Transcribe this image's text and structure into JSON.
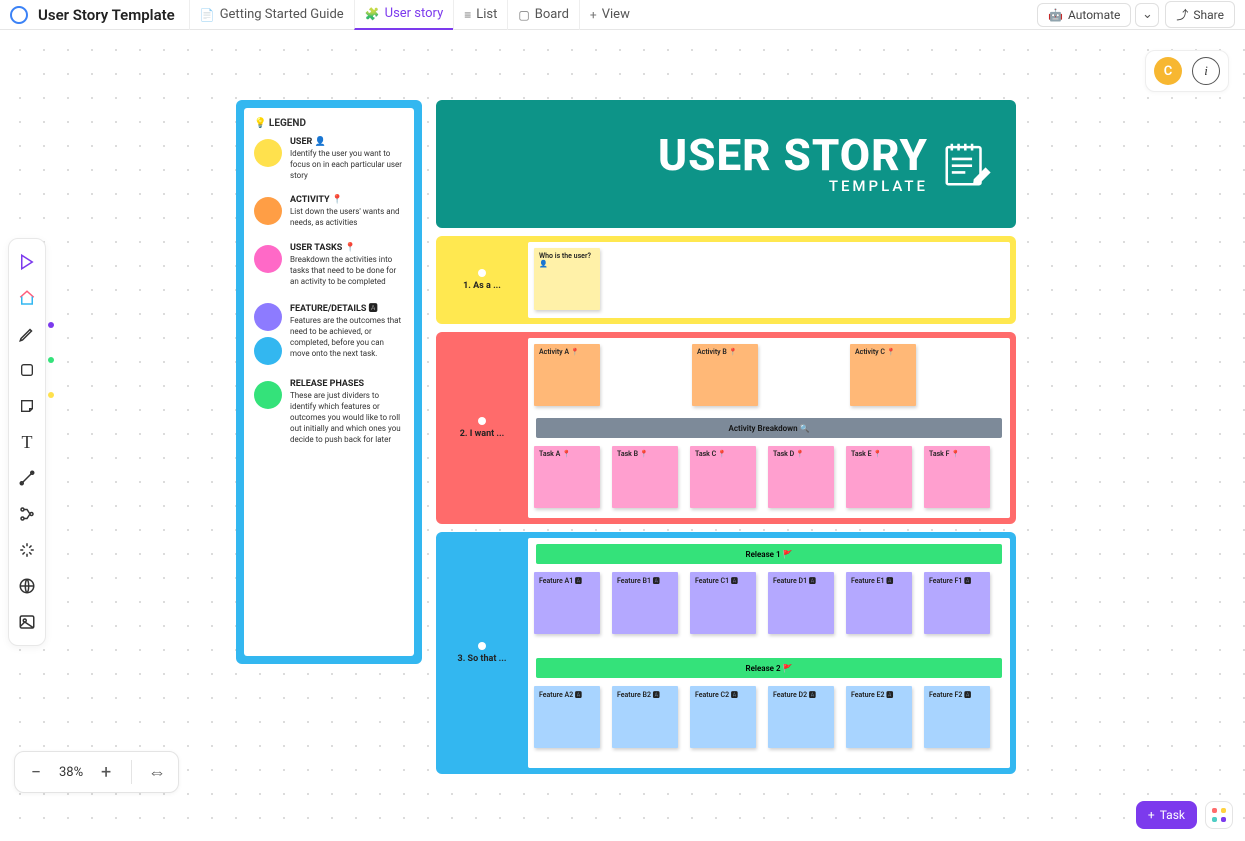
{
  "header": {
    "title": "User Story Template",
    "tabs": [
      {
        "label": "Getting Started Guide",
        "icon": "📄"
      },
      {
        "label": "User story",
        "icon": "🧩",
        "active": true
      },
      {
        "label": "List",
        "icon": "≡"
      },
      {
        "label": "Board",
        "icon": "▢"
      },
      {
        "label": "View",
        "icon": "+"
      }
    ],
    "automate": "Automate",
    "share": "Share"
  },
  "avatar": {
    "initial": "C"
  },
  "zoom": {
    "percent": "38%"
  },
  "bottom": {
    "task": "Task"
  },
  "legend": {
    "title": "💡 LEGEND",
    "items": [
      {
        "color": "#ffe14d",
        "heading": "USER 👤",
        "body": "Identify the user you want to focus on in each particular user story"
      },
      {
        "color": "#ff9e45",
        "heading": "ACTIVITY 📍",
        "body": "List down the users' wants and needs, as activities"
      },
      {
        "color": "#ff69c7",
        "heading": "USER TASKS 📍",
        "body": "Breakdown the activities into tasks that need to be done for an activity to be completed"
      },
      {
        "color": "#8d7bff",
        "heading": "FEATURE/DETAILS 🅰",
        "body": "Features are the outcomes that need to be achieved, or completed, before you can move onto the next task."
      },
      {
        "color2": "#33b7f0",
        "heading2_ignored": ""
      },
      {
        "color": "#34e27a",
        "heading": "RELEASE PHASES",
        "body": "These are just dividers to identify which features or outcomes you would like to roll out initially and which ones you decide to push back for later"
      }
    ],
    "featureSecondCircle": "#33b7f0"
  },
  "hero": {
    "title": "USER STORY",
    "subtitle": "TEMPLATE"
  },
  "sections": {
    "user": {
      "label": "1.  As a ...",
      "sticky": {
        "text": "Who is the user?",
        "emoji": "👤"
      }
    },
    "want": {
      "label": "2.  I want ...",
      "activities": [
        {
          "label": "Activity A 📍"
        },
        {
          "label": "Activity B 📍"
        },
        {
          "label": "Activity C 📍"
        }
      ],
      "breakdownBar": "Activity Breakdown 🔍",
      "tasks": [
        {
          "label": "Task A  📍"
        },
        {
          "label": "Task B  📍"
        },
        {
          "label": "Task C  📍"
        },
        {
          "label": "Task D  📍"
        },
        {
          "label": "Task E  📍"
        },
        {
          "label": "Task F  📍"
        }
      ]
    },
    "so": {
      "label": "3.  So that ...",
      "release1": "Release 1 🚩",
      "features1": [
        {
          "label": "Feature A1 🅰"
        },
        {
          "label": "Feature B1 🅰"
        },
        {
          "label": "Feature C1 🅰"
        },
        {
          "label": "Feature D1 🅰"
        },
        {
          "label": "Feature E1 🅰"
        },
        {
          "label": "Feature F1 🅰"
        }
      ],
      "release2": "Release 2 🚩",
      "features2": [
        {
          "label": "Feature A2 🅰"
        },
        {
          "label": "Feature B2 🅰"
        },
        {
          "label": "Feature C2 🅰"
        },
        {
          "label": "Feature D2 🅰"
        },
        {
          "label": "Feature E2 🅰"
        },
        {
          "label": "Feature F2 🅰"
        }
      ]
    }
  },
  "colors": {
    "stickyUser": "#fff1a8",
    "activity": "#ffb877",
    "task": "#ff9fcf",
    "feature1": "#b4a8ff",
    "feature2": "#a8d4ff",
    "releaseBar": "#34e27a",
    "breakdownBar": "#7d8a99"
  }
}
